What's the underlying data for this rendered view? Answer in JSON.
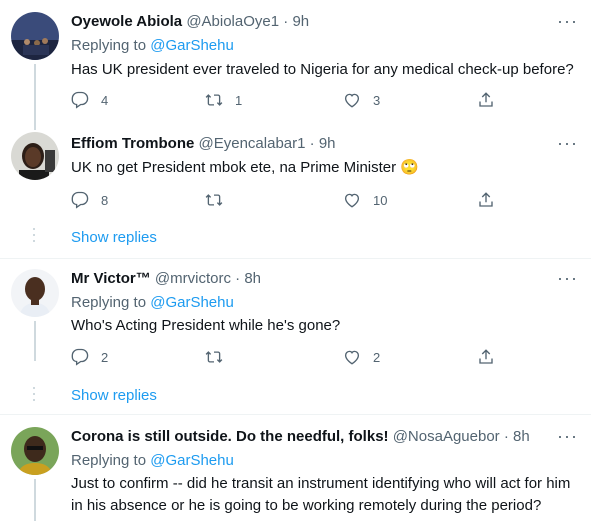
{
  "tweets": [
    {
      "name": "Oyewole Abiola",
      "handle": "@AbiolaOye1",
      "dot": "·",
      "time": "9h",
      "replying_prefix": "Replying to ",
      "replying_to": "@GarShehu",
      "text": "Has UK president ever traveled to Nigeria for any medical check-up before?",
      "replies": "4",
      "retweets": "1",
      "likes": "3"
    },
    {
      "name": "Effiom Trombone",
      "handle": "@Eyencalabar1",
      "dot": "·",
      "time": "9h",
      "text": "UK no get President mbok ete, na Prime Minister 🙄",
      "replies": "8",
      "retweets": "",
      "likes": "10",
      "show_replies": "Show replies"
    },
    {
      "name": "Mr Victor™",
      "handle": "@mrvictorc",
      "dot": "·",
      "time": "8h",
      "replying_prefix": "Replying to ",
      "replying_to": "@GarShehu",
      "text": "Who's Acting President while he's gone?",
      "replies": "2",
      "retweets": "",
      "likes": "2",
      "show_replies": "Show replies"
    },
    {
      "name": "Corona is still outside. Do the needful, folks!",
      "handle": "@NosaAguebor",
      "dot": "·",
      "time": "8h",
      "replying_prefix": "Replying to ",
      "replying_to": "@GarShehu",
      "text": "Just to confirm -- did he transit an instrument identifying who will act for him in his absence or he is going to be working remotely during the period?"
    }
  ],
  "icons": {
    "reply": "reply-icon",
    "retweet": "retweet-icon",
    "like": "heart-icon",
    "share": "share-icon",
    "more": "more-icon"
  },
  "colors": {
    "link": "#1d9bf0",
    "secondary": "#536471",
    "line": "#cfd9de"
  }
}
